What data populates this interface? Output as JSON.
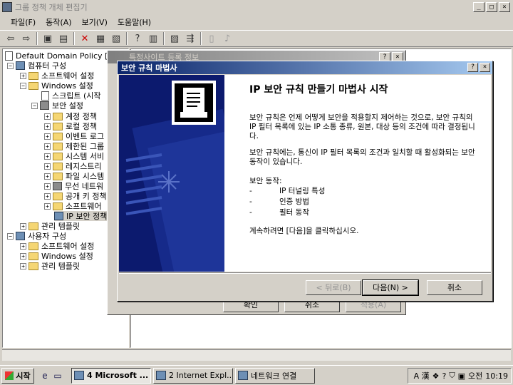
{
  "window": {
    "title": "그룹 정책 개체 편집기"
  },
  "menu": [
    {
      "label": "파일(F)"
    },
    {
      "label": "동작(A)"
    },
    {
      "label": "보기(V)"
    },
    {
      "label": "도움말(H)"
    }
  ],
  "tree": {
    "root": "Default Domain Policy [I",
    "computer": "컴퓨터 구성",
    "software_settings": "소프트웨어 설정",
    "windows_settings": "Windows 설정",
    "scripts": "스크립트 (시작",
    "security_settings": "보안 설정",
    "account_policy": "계정 정책",
    "local_policy": "로컬 정책",
    "event_log": "이벤트 로그",
    "restricted_groups": "제한된 그룹",
    "system_services": "시스템 서비",
    "registry": "레지스트리",
    "file_system": "파일 시스템",
    "wireless": "무선 네트워",
    "public_key": "공개 키 정책",
    "software_restriction": "소프트웨어",
    "ip_security": "IP 보안 정책",
    "admin_templates": "관리 템플릿",
    "user": "사용자 구성",
    "user_software_settings": "소프트웨어 설정",
    "user_windows_settings": "Windows 설정",
    "user_admin_templates": "관리 템플릿"
  },
  "prop_dialog": {
    "title": "특정사이트 등록 정보",
    "ok_label": "확인",
    "cancel_label": "취소",
    "apply_label": "적용(A)"
  },
  "wizard": {
    "title": "보안 규칙 마법사",
    "heading": "IP 보안 규칙 만들기 마법사 시작",
    "para1": "보안 규칙은 언제 어떻게 보안을 적용할지 제어하는 것으로, 보안 규칙의 IP 필터 목록에 있는 IP 소통 종류, 원본, 대상 등의 조건에 따라 결정됩니다.",
    "para2": "보안 규칙에는, 통신이 IP 필터 목록의 조건과 일치할 때 활성화되는 보안 동작이 있습니다.",
    "actions_label": "보안 동작:",
    "actions": [
      "IP 터널링 특성",
      "인증 방법",
      "필터 동작"
    ],
    "bullet": "-",
    "continue_text": "계속하려면 [다음]을 클릭하십시오.",
    "back_label": "< 뒤로(B)",
    "next_label": "다음(N) >",
    "cancel_label": "취소"
  },
  "taskbar": {
    "start_label": "시작",
    "tasks": [
      {
        "label": "4 Microsoft ..."
      },
      {
        "label": "2 Internet Expl..."
      },
      {
        "label": "네트워크 연결"
      }
    ],
    "ime": "A 漢",
    "am_pm": "오전",
    "clock": "10:19"
  }
}
